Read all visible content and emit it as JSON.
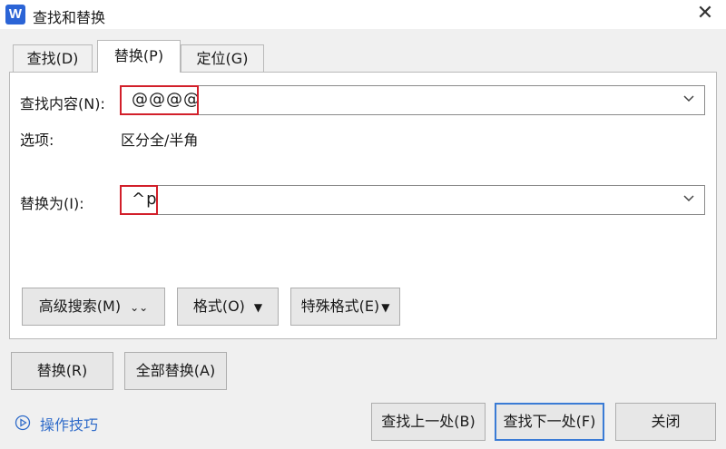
{
  "window": {
    "title": "查找和替换",
    "app_badge": "W",
    "close_glyph": "✕"
  },
  "tabs": [
    {
      "label": "查找(D)"
    },
    {
      "label": "替换(P)"
    },
    {
      "label": "定位(G)"
    }
  ],
  "active_tab": "替换(P)",
  "find": {
    "label": "查找内容(N):",
    "value": "@@@@"
  },
  "options": {
    "label": "选项:",
    "value": "区分全/半角"
  },
  "replace": {
    "label": "替换为(I):",
    "value": "^p"
  },
  "panel_buttons": {
    "advanced": "高级搜索(M)",
    "advanced_arrow": "⌄⌄",
    "format": "格式(O)",
    "format_arrow": "▼",
    "special": "特殊格式(E)",
    "special_arrow": "▼"
  },
  "action_buttons": {
    "replace": "替换(R)",
    "replace_all": "全部替换(A)",
    "find_prev": "查找上一处(B)",
    "find_next": "查找下一处(F)",
    "close": "关闭"
  },
  "tips": {
    "label": "操作技巧"
  },
  "colors": {
    "accent": "#3a7bd5",
    "highlight": "#d21f2a",
    "link": "#2f6bc9"
  }
}
